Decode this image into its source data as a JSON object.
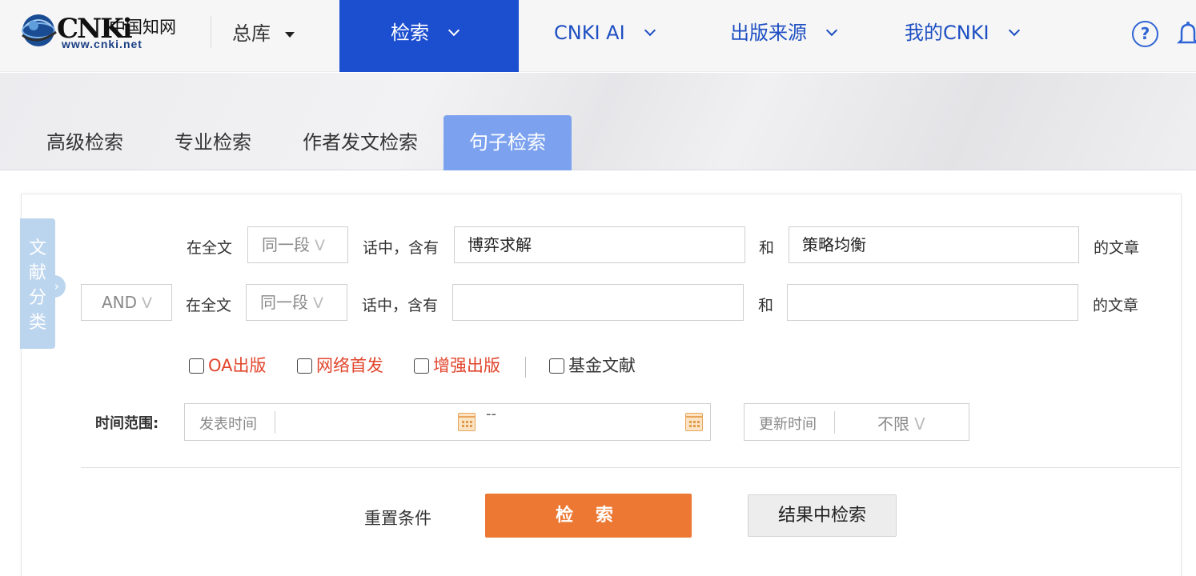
{
  "logo": {
    "brand": "CNKi",
    "chinese": "中国知网",
    "url_text": "www.cnki.net"
  },
  "nav": {
    "library": "总库",
    "search": "检索",
    "cnki_ai": "CNKI AI",
    "sources": "出版来源",
    "my_cnki": "我的CNKI",
    "help_glyph": "?"
  },
  "tabs": [
    {
      "label": "高级检索"
    },
    {
      "label": "专业检索"
    },
    {
      "label": "作者发文检索"
    },
    {
      "label": "句子检索",
      "active": true
    }
  ],
  "category_tab": {
    "label": "文献分类"
  },
  "rows": [
    {
      "prefix": "在全文",
      "scope": "同一段",
      "connector": "话中，含有",
      "term1": "博弈求解",
      "and": "和",
      "term2": "策略均衡",
      "suffix": "的文章"
    },
    {
      "logic": "AND",
      "prefix": "在全文",
      "scope": "同一段",
      "connector": "话中，含有",
      "term1": "",
      "and": "和",
      "term2": "",
      "suffix": "的文章"
    }
  ],
  "filters": [
    {
      "label": "OA出版",
      "checked": false,
      "color": "#e1452c"
    },
    {
      "label": "网络首发",
      "checked": false,
      "color": "#e1452c"
    },
    {
      "label": "增强出版",
      "checked": false,
      "color": "#e1452c"
    },
    {
      "label": "基金文献",
      "checked": false,
      "color": "#333333"
    }
  ],
  "time": {
    "label": "时间范围:",
    "publish_label": "发表时间",
    "range_sep": "--",
    "update_label": "更新时间",
    "update_value": "不限"
  },
  "dropdown_glyph": "V",
  "actions": {
    "reset": "重置条件",
    "search": "检 索",
    "search_within": "结果中检索"
  },
  "colors": {
    "primary_blue": "#1c4ed0",
    "tab_active": "#7ca2ef",
    "search_orange": "#ec7833",
    "filter_red": "#e1452c"
  }
}
